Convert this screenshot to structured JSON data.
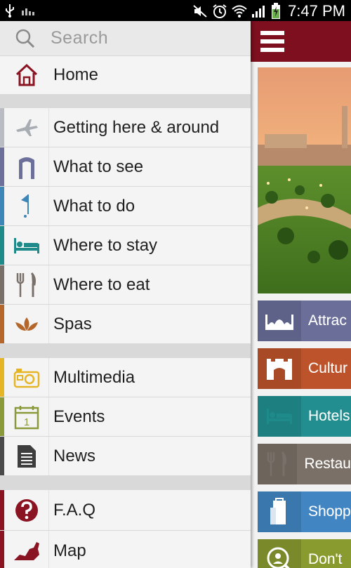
{
  "status_bar": {
    "time": "7:47 PM",
    "icons": [
      "usb-icon",
      "signal-bars-small-icon",
      "mute-icon",
      "alarm-icon",
      "wifi-icon",
      "cell-signal-icon",
      "battery-charging-icon"
    ]
  },
  "drawer": {
    "search_placeholder": "Search",
    "home": {
      "label": "Home",
      "icon": "house-icon"
    },
    "group1": [
      {
        "label": "Getting here & around",
        "icon": "airplane-icon",
        "accent": "#b9bcc3"
      },
      {
        "label": "What to see",
        "icon": "arch-icon",
        "accent": "#6b6f9a"
      },
      {
        "label": "What to do",
        "icon": "golf-flag-icon",
        "accent": "#3f86b8"
      },
      {
        "label": "Where to stay",
        "icon": "bed-icon",
        "accent": "#1f8a8a"
      },
      {
        "label": "Where to eat",
        "icon": "fork-knife-icon",
        "accent": "#7a706a"
      },
      {
        "label": "Spas",
        "icon": "lotus-icon",
        "accent": "#b5672b"
      }
    ],
    "group2": [
      {
        "label": "Multimedia",
        "icon": "camera-icon",
        "accent": "#e6b526"
      },
      {
        "label": "Events",
        "icon": "calendar-icon",
        "accent": "#8a9a3a"
      },
      {
        "label": "News",
        "icon": "newspaper-icon",
        "accent": "#4a4a4a"
      }
    ],
    "group3": [
      {
        "label": "F.A.Q",
        "icon": "question-icon",
        "accent": "#8a1422"
      },
      {
        "label": "Map",
        "icon": "map-icon",
        "accent": "#8a1422"
      }
    ]
  },
  "app": {
    "brand_color": "#7d0f1f",
    "tiles": [
      {
        "label": "Attrac",
        "icon": "mosque-icon",
        "color": "#5f6288"
      },
      {
        "label": "Cultur",
        "icon": "fort-icon",
        "color": "#a94a26"
      },
      {
        "label": "Hotels",
        "icon": "bed-icon",
        "color": "#1e7f80"
      },
      {
        "label": "Restau",
        "icon": "fork-knife-icon",
        "color": "#6d645c"
      },
      {
        "label": "Shopp",
        "icon": "shopping-bag-icon",
        "color": "#3a77ad"
      },
      {
        "label": "Don't",
        "icon": "magnifier-icon",
        "color": "#7a8a2a"
      }
    ]
  }
}
